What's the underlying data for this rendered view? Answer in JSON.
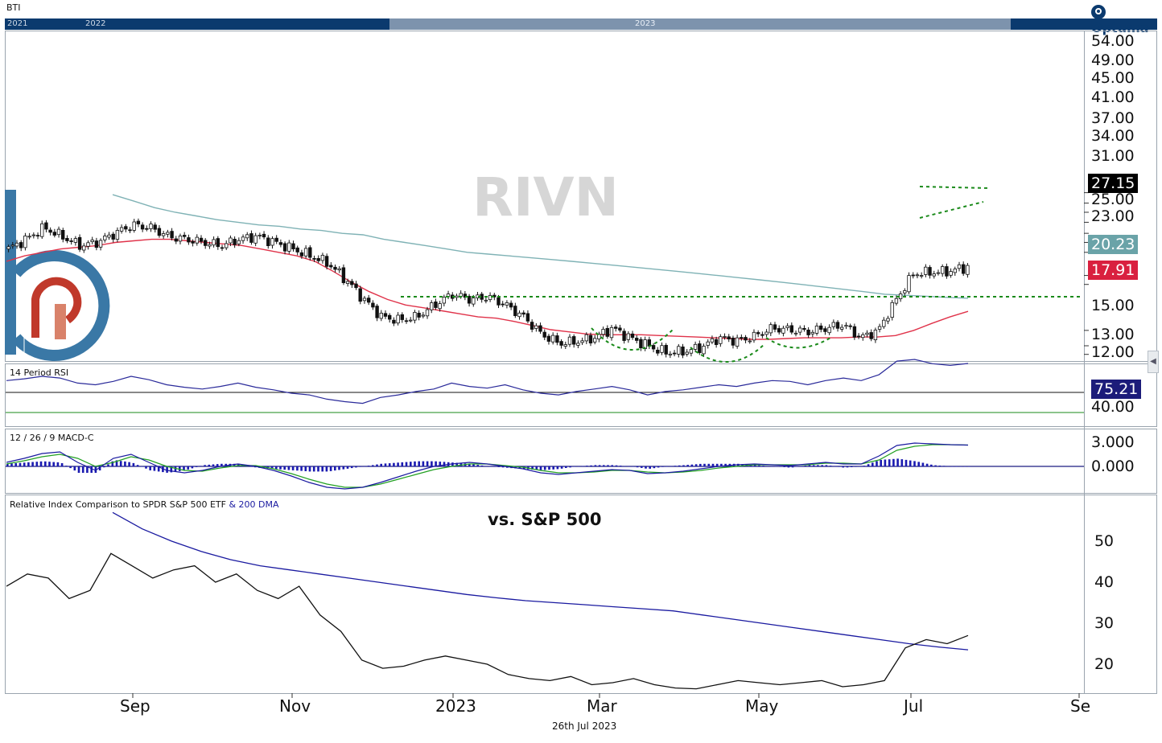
{
  "header": {
    "symbol": "BTI",
    "brand": "Optuma",
    "timeline_years": [
      "2021",
      "2022",
      "2023"
    ]
  },
  "watermark": "RIVN",
  "panels": {
    "rsi_title": "14 Period RSI",
    "macd_title": "12 / 26 / 9 MACD-C",
    "rel_title": "Relative Index Comparison to SPDR S&P 500 ETF",
    "rel_title_dma": "& 200 DMA",
    "rel_annotation": "vs. S&P 500"
  },
  "price_axis": [
    "54.00",
    "49.00",
    "45.00",
    "41.00",
    "37.00",
    "34.00",
    "31.00",
    "25.00",
    "23.00",
    "15.00",
    "13.00",
    "12.00"
  ],
  "price_tags": {
    "last": "27.15",
    "ma200": "20.23",
    "ma50": "17.91"
  },
  "rsi_axis": [
    "40.00"
  ],
  "rsi_tag": "75.21",
  "macd_axis": [
    "3.000",
    "0.000"
  ],
  "rel_axis": [
    "50",
    "40",
    "30",
    "20"
  ],
  "x_labels": [
    "Sep",
    "Nov",
    "2023",
    "Mar",
    "May",
    "Jul",
    "Se"
  ],
  "footer_date": "26th Jul 2023",
  "colors": {
    "navy": "#0b3a6e",
    "ma50": "#e0334a",
    "ma200": "#7fb2b5",
    "tag_last": "#000000",
    "tag_ma200": "#6aa3a8",
    "tag_ma50": "#d9203f",
    "tag_rsi": "#1c1c7a",
    "pattern": "#1a8a1a",
    "macd_line": "#1a1aa0",
    "signal_line": "#22a022",
    "dma_line": "#1a1aa0",
    "logo_blue": "#3a78a6",
    "logo_red": "#c0392b"
  },
  "chart_data": [
    {
      "type": "candlestick",
      "title": "BTI",
      "xlabels": [
        "Sep",
        "Nov",
        "2023",
        "Mar",
        "May",
        "Jul"
      ],
      "ylim": [
        11,
        58
      ],
      "y_scale": "log",
      "series": [
        {
          "name": "price",
          "values": [
            32,
            35,
            39,
            36,
            33,
            34,
            37,
            40,
            39,
            36,
            35,
            34,
            33,
            35,
            36,
            34,
            32,
            30,
            28,
            24,
            20,
            17,
            16.5,
            17,
            19,
            21,
            20,
            20.5,
            19,
            17,
            14.5,
            13.3,
            13.5,
            14,
            15.3,
            14,
            13,
            12.2,
            12.3,
            12.8,
            14,
            13.6,
            14.2,
            15.3,
            15.1,
            14.8,
            15.3,
            15.8,
            14,
            15,
            20,
            25.5,
            25.7,
            26,
            27.15
          ]
        },
        {
          "name": "ma50",
          "values": [
            28.5,
            30,
            31,
            32,
            32.5,
            33,
            34,
            34.5,
            35,
            35,
            34.5,
            34,
            33.5,
            33,
            32,
            31,
            30,
            28.5,
            26,
            23.5,
            21.5,
            20,
            19,
            18.5,
            18,
            17.5,
            17,
            16.8,
            16.3,
            15.7,
            15.1,
            14.8,
            14.5,
            14.4,
            14.4,
            14.4,
            14.3,
            14.2,
            14.1,
            14,
            13.9,
            13.8,
            13.8,
            13.9,
            14,
            14,
            14,
            14.1,
            14.1,
            14.3,
            15,
            16,
            17,
            17.9
          ]
        },
        {
          "name": "ma200",
          "values": [
            53,
            50,
            47,
            45,
            43.5,
            42,
            41,
            40,
            39.5,
            38.5,
            38,
            37,
            36.5,
            35,
            34,
            33,
            32,
            31,
            30.5,
            30,
            29.5,
            29,
            28.5,
            28,
            27.5,
            27,
            26.5,
            26,
            25.5,
            25,
            24.5,
            24,
            23.5,
            23,
            22.5,
            22,
            21.5,
            21,
            20.8,
            20.6,
            20.4,
            20.23
          ]
        }
      ],
      "annotations": [
        "neckline ~16",
        "inverse head and shoulders",
        "bull flag"
      ]
    },
    {
      "type": "line",
      "title": "14 Period RSI",
      "ylim": [
        0,
        100
      ],
      "series": [
        {
          "name": "RSI",
          "values": [
            55,
            57,
            60,
            58,
            52,
            50,
            54,
            60,
            56,
            50,
            47,
            45,
            48,
            52,
            47,
            44,
            40,
            38,
            33,
            30,
            28,
            35,
            38,
            42,
            45,
            52,
            48,
            46,
            50,
            44,
            40,
            38,
            42,
            45,
            48,
            44,
            38,
            42,
            44,
            47,
            50,
            48,
            52,
            55,
            54,
            50,
            55,
            58,
            55,
            62,
            78,
            80,
            75,
            73,
            75.21
          ]
        }
      ],
      "reference_lines": [
        70,
        30
      ]
    },
    {
      "type": "line",
      "title": "12 / 26 / 9 MACD-C",
      "ylim": [
        -3,
        3.5
      ],
      "series": [
        {
          "name": "MACD",
          "values": [
            0.5,
            1,
            1.6,
            1.8,
            0.5,
            -0.5,
            1,
            1.5,
            0.5,
            -0.5,
            -0.8,
            -0.5,
            0,
            0.3,
            0,
            -0.5,
            -1.2,
            -2,
            -2.6,
            -2.8,
            -2.6,
            -2,
            -1.3,
            -0.6,
            0,
            0.3,
            0.5,
            0.3,
            0,
            -0.3,
            -0.8,
            -1,
            -0.8,
            -0.6,
            -0.4,
            -0.5,
            -0.9,
            -0.8,
            -0.6,
            -0.3,
            0,
            0.2,
            0.3,
            0.2,
            0.1,
            0.3,
            0.5,
            0.3,
            0.3,
            1.3,
            2.6,
            2.9,
            2.8,
            2.7,
            2.65
          ]
        },
        {
          "name": "Signal",
          "values": [
            0.3,
            0.7,
            1.2,
            1.5,
            1,
            0,
            0.5,
            1.2,
            0.8,
            0,
            -0.5,
            -0.6,
            -0.2,
            0.1,
            0.1,
            -0.3,
            -0.9,
            -1.6,
            -2.2,
            -2.6,
            -2.6,
            -2.2,
            -1.6,
            -1,
            -0.4,
            0,
            0.3,
            0.3,
            0.1,
            -0.1,
            -0.5,
            -0.8,
            -0.8,
            -0.7,
            -0.5,
            -0.5,
            -0.7,
            -0.8,
            -0.7,
            -0.5,
            -0.2,
            0,
            0.2,
            0.2,
            0.2,
            0.2,
            0.4,
            0.4,
            0.3,
            0.8,
            2,
            2.5,
            2.7,
            2.7,
            2.65
          ]
        }
      ]
    },
    {
      "type": "line",
      "title": "Relative Index Comparison to SPDR S&P 500 ETF",
      "ylim": [
        13,
        58
      ],
      "series": [
        {
          "name": "Relative",
          "values": [
            39,
            42,
            41,
            36,
            38,
            47,
            44,
            41,
            43,
            44,
            40,
            42,
            38,
            36,
            39,
            32,
            28,
            21,
            19,
            19.5,
            21,
            22,
            21,
            20,
            17.5,
            16.5,
            16,
            17,
            15,
            15.5,
            16.5,
            15,
            14.2,
            14,
            15,
            16,
            15.5,
            15,
            15.5,
            16,
            14.5,
            15,
            16,
            24,
            26,
            25,
            27
          ]
        },
        {
          "name": "200 DMA",
          "values": [
            57,
            53,
            50,
            47.5,
            45.5,
            44,
            43,
            42,
            41,
            40,
            39,
            38,
            37,
            36.2,
            35.5,
            35,
            34.5,
            34,
            33.5,
            33,
            32,
            31,
            30,
            29,
            28,
            27,
            26,
            25,
            24.2,
            23.5
          ]
        }
      ]
    }
  ]
}
